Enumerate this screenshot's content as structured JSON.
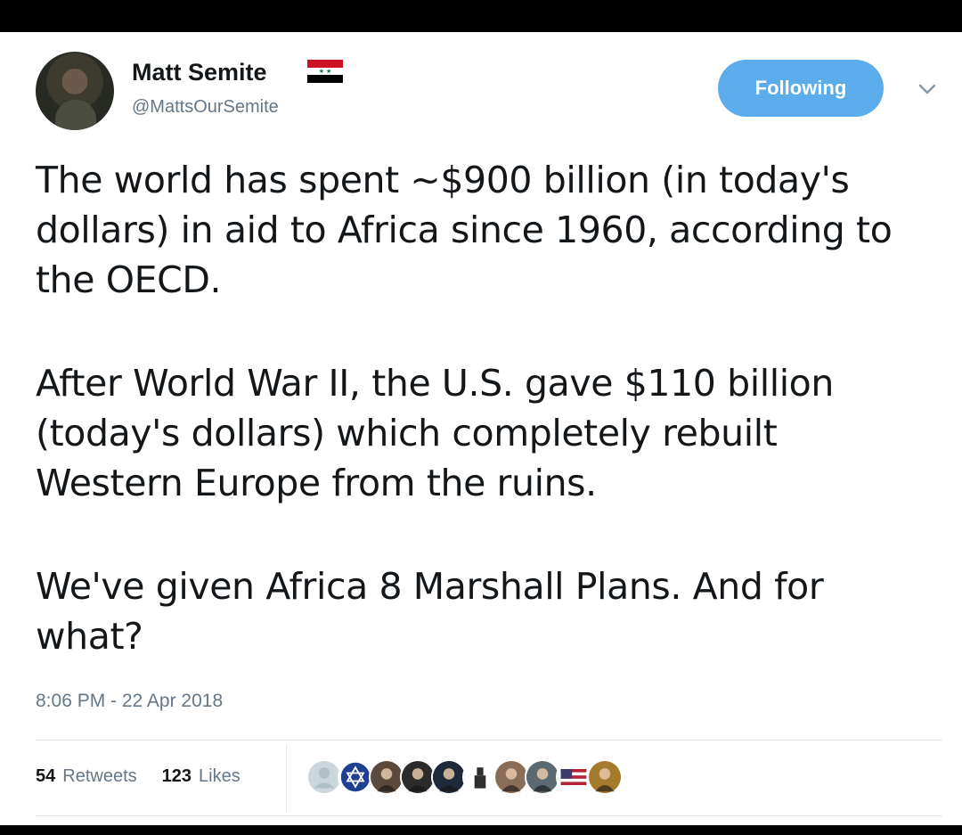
{
  "tweet": {
    "author": {
      "name": "Matt Semite",
      "handle": "@MattsOurSemite",
      "avatar_icon": "profile-photo",
      "flag_icon": "syria-flag-icon",
      "flag_colors": [
        "#ce1126",
        "#ffffff",
        "#000000"
      ]
    },
    "follow_label": "Following",
    "menu_icon": "chevron-down-icon",
    "paragraphs": [
      "The world has spent ~$900 billion (in today's dollars) in aid to Africa since 1960, according to the OECD.",
      "After World War II, the U.S. gave $110 billion (today's dollars) which completely rebuilt Western Europe from the ruins.",
      "We've given Africa 8 Marshall Plans. And for what?"
    ],
    "timestamp": "8:06 PM - 22 Apr 2018",
    "retweets": {
      "count": "54",
      "label": "Retweets"
    },
    "likes": {
      "count": "123",
      "label": "Likes"
    },
    "likers": [
      {
        "icon": "default-avatar-icon",
        "color": "#b0bec5"
      },
      {
        "icon": "star-of-david-avatar-icon",
        "color": "#1f3f8f"
      },
      {
        "icon": "portrait-avatar-icon",
        "color": "#5b4a3c"
      },
      {
        "icon": "portrait-avatar-icon",
        "color": "#2b2b2b"
      },
      {
        "icon": "portrait-avatar-icon",
        "color": "#1e2a3a"
      },
      {
        "icon": "statue-avatar-icon",
        "color": "#2e2e2e"
      },
      {
        "icon": "portrait-avatar-icon",
        "color": "#8a6d57"
      },
      {
        "icon": "portrait-avatar-icon",
        "color": "#5a6a70"
      },
      {
        "icon": "flag-avatar-icon",
        "color": "#b22234"
      },
      {
        "icon": "portrait-avatar-icon",
        "color": "#a47a2c"
      }
    ]
  },
  "colors": {
    "accent": "#5aacea",
    "text": "#14171a",
    "muted": "#657786",
    "border": "#e1e8ed"
  }
}
